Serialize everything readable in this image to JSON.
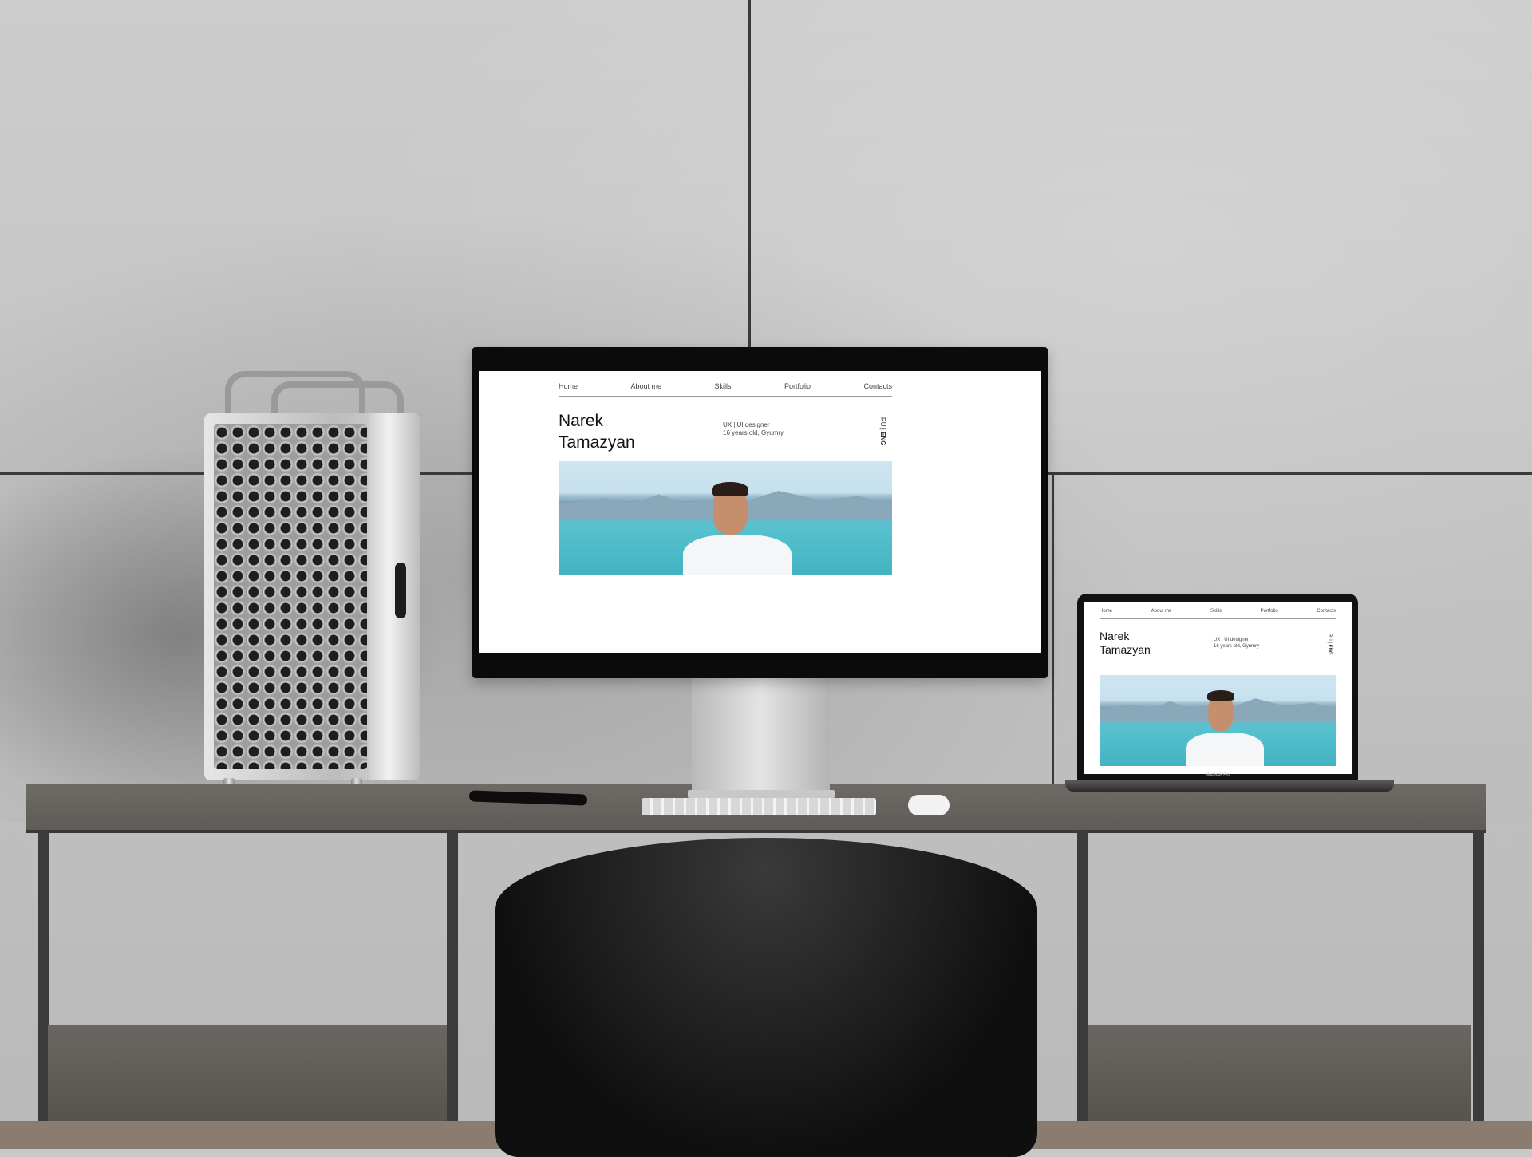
{
  "site": {
    "nav": [
      "Home",
      "About me",
      "Skills",
      "Portfolio",
      "Contacts"
    ],
    "name_first": "Narek",
    "name_last": "Tamazyan",
    "role": "UX | UI designer",
    "bio": "16 years old, Gyumry",
    "lang_ru": "RU",
    "lang_sep": "|",
    "lang_eng": "ENG",
    "hero_alt": "portrait-photo-sea"
  },
  "laptop": {
    "brand": "MacBook Pro"
  },
  "colors": {
    "page_bg": "#ffffff",
    "sea": "#43b3c2",
    "sky": "#cfe6f1",
    "text": "#111111"
  }
}
